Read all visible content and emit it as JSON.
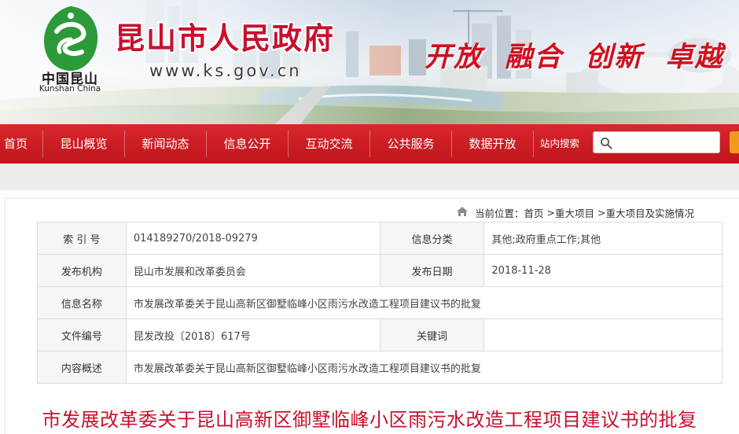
{
  "header": {
    "site_title": "昆山市人民政府",
    "site_url": "www.ks.gov.cn",
    "logo_text_cn": "中国昆山",
    "logo_text_en": "Kunshan China",
    "slogan": "开放 融合 创新 卓越"
  },
  "nav": {
    "items": [
      {
        "label": "首页"
      },
      {
        "label": "昆山概览"
      },
      {
        "label": "新闻动态"
      },
      {
        "label": "信息公开"
      },
      {
        "label": "互动交流"
      },
      {
        "label": "公共服务"
      },
      {
        "label": "数据开放"
      }
    ],
    "search_label": "站内搜索",
    "search_placeholder": ""
  },
  "breadcrumb": {
    "prefix": "当前位置：",
    "items": [
      "首页",
      "重大项目",
      "重大项目及实施情况"
    ],
    "separator": " >"
  },
  "info": {
    "index_label": "索 引 号",
    "index_value": "014189270/2018-09279",
    "category_label": "信息分类",
    "category_value": "其他;政府重点工作;其他",
    "publisher_label": "发布机构",
    "publisher_value": "昆山市发展和改革委员会",
    "date_label": "发布日期",
    "date_value": "2018-11-28",
    "name_label": "信息名称",
    "name_value": "市发展改革委关于昆山高新区御墅临峰小区雨污水改造工程项目建议书的批复",
    "docno_label": "文件编号",
    "docno_value": "昆发改投〔2018〕617号",
    "keyword_label": "关键词",
    "keyword_value": "",
    "summary_label": "内容概述",
    "summary_value": "市发展改革委关于昆山高新区御墅临峰小区雨污水改造工程项目建议书的批复"
  },
  "article": {
    "title": "市发展改革委关于昆山高新区御墅临峰小区雨污水改造工程项目建议书的批复"
  },
  "colors": {
    "brand_red": "#c8102e",
    "nav_red": "#c0141b",
    "search_orange": "#f29a1e",
    "logo_green": "#2d9a3a"
  },
  "icons": {
    "logo": "kunshan-logo-icon",
    "search": "search-icon",
    "home": "home-icon"
  }
}
